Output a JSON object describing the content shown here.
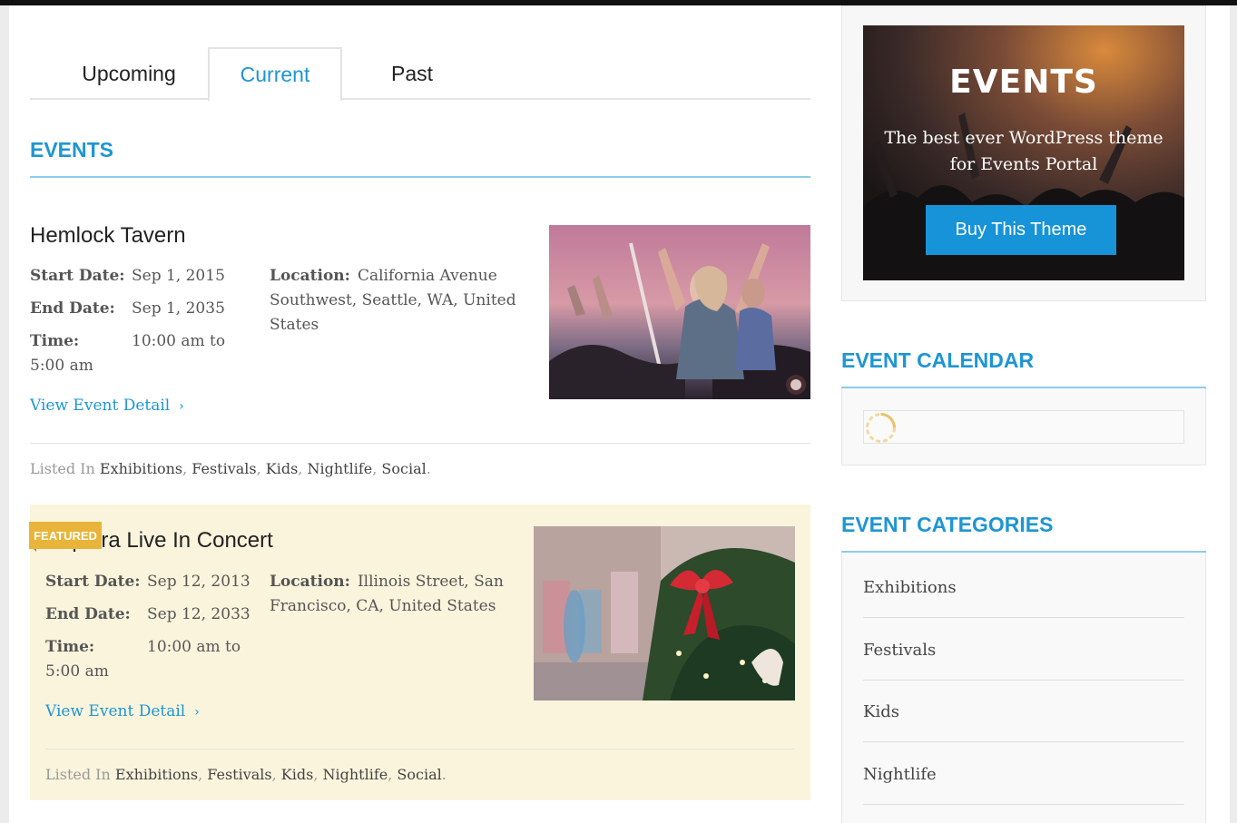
{
  "tabs": [
    {
      "label": "Upcoming"
    },
    {
      "label": "Current"
    },
    {
      "label": "Past"
    }
  ],
  "active_tab": "Current",
  "events_heading": "EVENTS",
  "events": [
    {
      "title": "Hemlock Tavern",
      "start_label": "Start Date:",
      "start": "Sep 1, 2015",
      "end_label": "End Date:",
      "end": "Sep 1, 2035",
      "time_label": "Time:",
      "time_line1": "10:00 am to",
      "time_line2": "5:00 am",
      "location_label": "Location:",
      "location": "California Avenue Southwest, Seattle, WA, United States",
      "detail_link": "View Event Detail",
      "listed_in": "Listed In",
      "categories": [
        "Exhibitions",
        "Festivals",
        "Kids",
        "Nightlife",
        "Social"
      ],
      "featured": false
    },
    {
      "title": "Sephira Live In Concert",
      "start_label": "Start Date:",
      "start": "Sep 12, 2013",
      "end_label": "End Date:",
      "end": "Sep 12, 2033",
      "time_label": "Time:",
      "time_line1": "10:00 am to",
      "time_line2": "5:00 am",
      "location_label": "Location:",
      "location": "Illinois Street, San Francisco, CA, United States",
      "detail_link": "View Event Detail",
      "listed_in": "Listed In",
      "categories": [
        "Exhibitions",
        "Festivals",
        "Kids",
        "Nightlife",
        "Social"
      ],
      "featured": true,
      "featured_label": "FEATURED"
    }
  ],
  "sidebar": {
    "ad": {
      "title": "EVENTS",
      "subtitle_line1": "The best ever WordPress theme",
      "subtitle_line2": "for Events Portal",
      "button": "Buy This Theme"
    },
    "calendar_heading": "EVENT CALENDAR",
    "categories_heading": "EVENT CATEGORIES",
    "categories": [
      "Exhibitions",
      "Festivals",
      "Kids",
      "Nightlife"
    ]
  },
  "colors": {
    "accent": "#1e96d3",
    "featured_bg": "#faf4dc",
    "featured_badge": "#e8b43a",
    "button": "#1793d8"
  }
}
